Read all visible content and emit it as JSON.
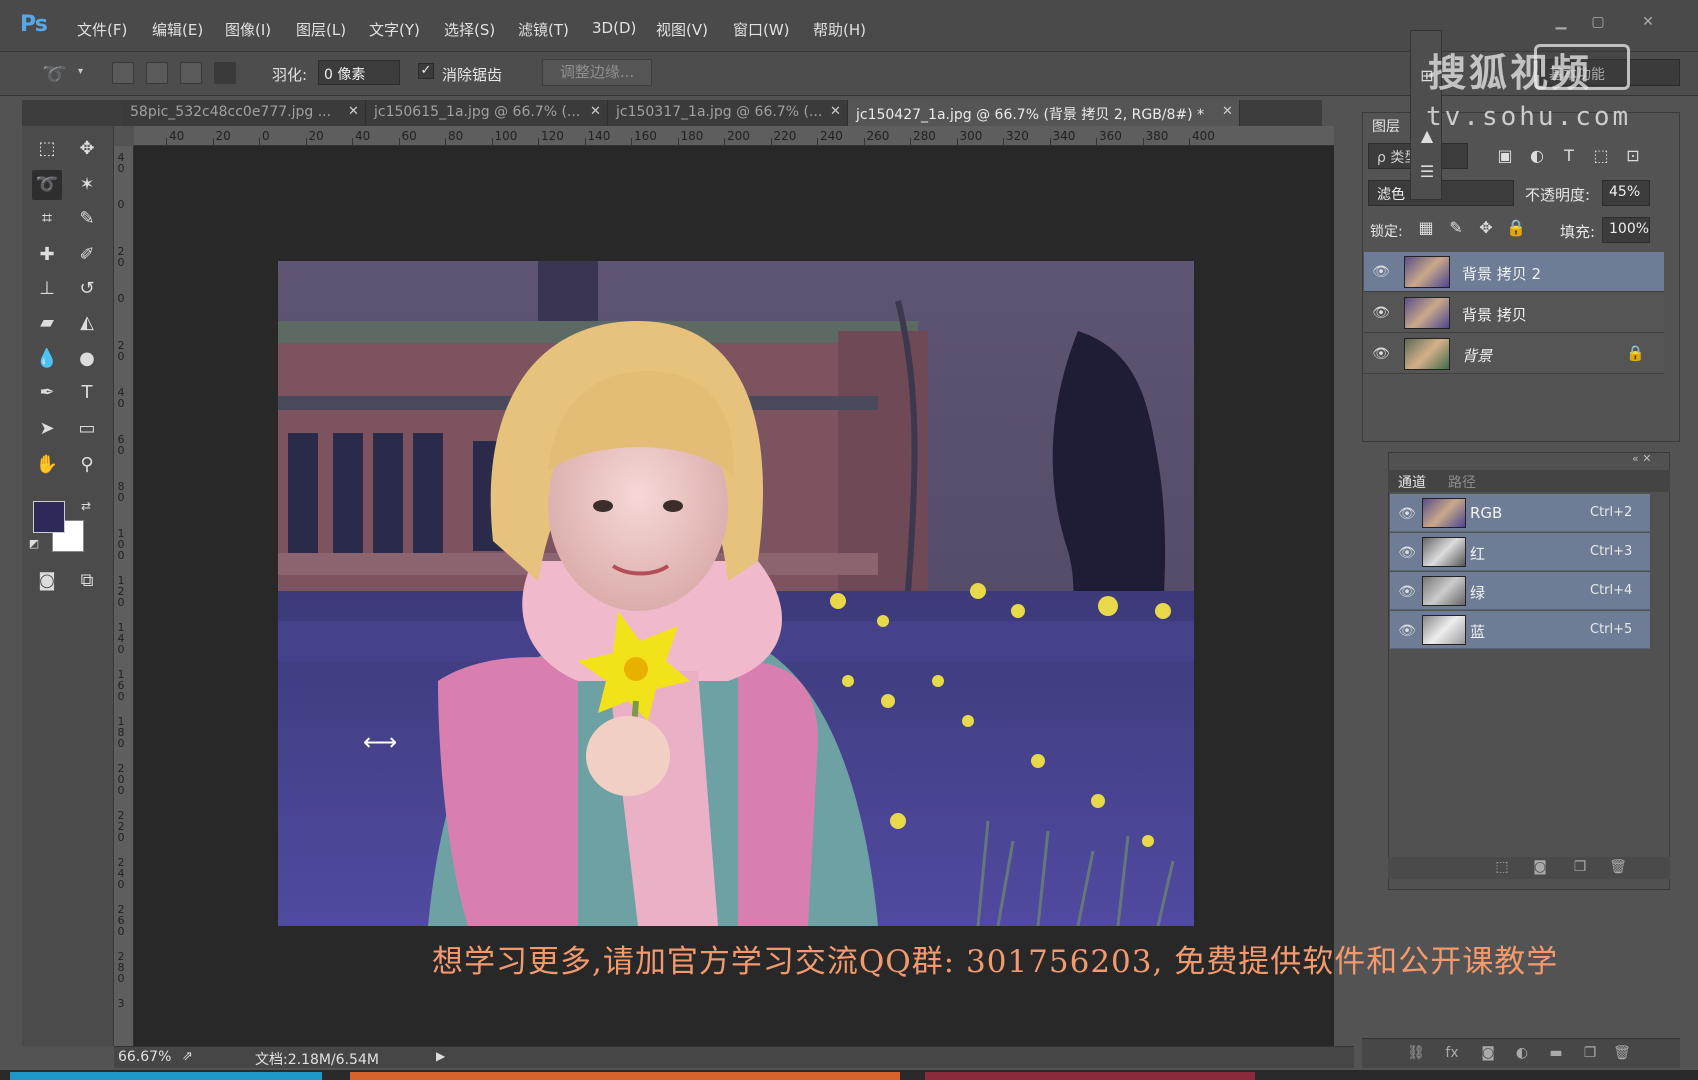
{
  "app": {
    "logo": "Ps",
    "menu": [
      "文件(F)",
      "编辑(E)",
      "图像(I)",
      "图层(L)",
      "文字(Y)",
      "选择(S)",
      "滤镜(T)",
      "3D(D)",
      "视图(V)",
      "窗口(W)",
      "帮助(H)"
    ],
    "window_controls": [
      "minimize",
      "maximize",
      "close"
    ]
  },
  "options": {
    "feather_label": "羽化:",
    "feather_value": "0 像素",
    "antialias_checked": true,
    "antialias_label": "消除锯齿",
    "refine_edge_label": "调整边缘...",
    "workspace": "基本功能"
  },
  "tabs": [
    {
      "label": "58pic_532c48cc0e777.jpg ...",
      "active": false
    },
    {
      "label": "jc150615_1a.jpg @ 66.7% (...",
      "active": false
    },
    {
      "label": "jc150317_1a.jpg @ 66.7% (...",
      "active": false
    },
    {
      "label": "jc150427_1a.jpg @ 66.7% (背景 拷贝 2, RGB/8#) *",
      "active": true
    }
  ],
  "ruler": {
    "horizontal": [
      "40",
      "20",
      "0",
      "20",
      "40",
      "60",
      "80",
      "100",
      "120",
      "140",
      "160",
      "180",
      "200",
      "220",
      "240",
      "260",
      "280",
      "300",
      "320",
      "340",
      "360",
      "380",
      "400"
    ],
    "vertical": [
      "40",
      "0",
      "20",
      "0",
      "20",
      "40",
      "60",
      "80",
      "100",
      "120",
      "140",
      "160",
      "180",
      "200",
      "220",
      "240",
      "260",
      "280",
      "3"
    ]
  },
  "tools": [
    "marquee-icon",
    "move-icon",
    "lasso-icon",
    "magic-wand-icon",
    "crop-icon",
    "eyedropper-icon",
    "healing-brush-icon",
    "brush-icon",
    "clone-stamp-icon",
    "history-brush-icon",
    "eraser-icon",
    "paint-bucket-icon",
    "blur-icon",
    "dodge-icon",
    "pen-icon",
    "type-icon",
    "path-select-icon",
    "rectangle-icon",
    "hand-icon",
    "zoom-icon",
    "quick-mask-icon",
    "screen-mode-icon"
  ],
  "colors": {
    "foreground": "#2d2a5a",
    "background": "#ffffff",
    "selected_row": "#6e7c96",
    "subtitle": "#f29a6e"
  },
  "subtitle": "想学习更多,请加官方学习交流QQ群: 301756203, 免费提供软件和公开课教学",
  "status": {
    "zoom": "66.67%",
    "doc": "文档:2.18M/6.54M"
  },
  "layers_panel": {
    "title": "图层",
    "search_placeholder": "ρ 类型",
    "blend_mode": "滤色",
    "opacity_label": "不透明度:",
    "opacity_value": "45%",
    "lock_label": "锁定:",
    "fill_label": "填充:",
    "fill_value": "100%",
    "layers": [
      {
        "name": "背景 拷贝 2",
        "selected": true,
        "locked": false
      },
      {
        "name": "背景 拷贝",
        "selected": false,
        "locked": false
      },
      {
        "name": "背景",
        "selected": false,
        "locked": true
      }
    ]
  },
  "channels_panel": {
    "tabs": [
      "通道",
      "路径"
    ],
    "channels": [
      {
        "name": "RGB",
        "shortcut": "Ctrl+2"
      },
      {
        "name": "红",
        "shortcut": "Ctrl+3"
      },
      {
        "name": "绿",
        "shortcut": "Ctrl+4"
      },
      {
        "name": "蓝",
        "shortcut": "Ctrl+5"
      }
    ]
  },
  "watermark": {
    "text": "搜狐视频",
    "url": "tv.sohu.com"
  }
}
